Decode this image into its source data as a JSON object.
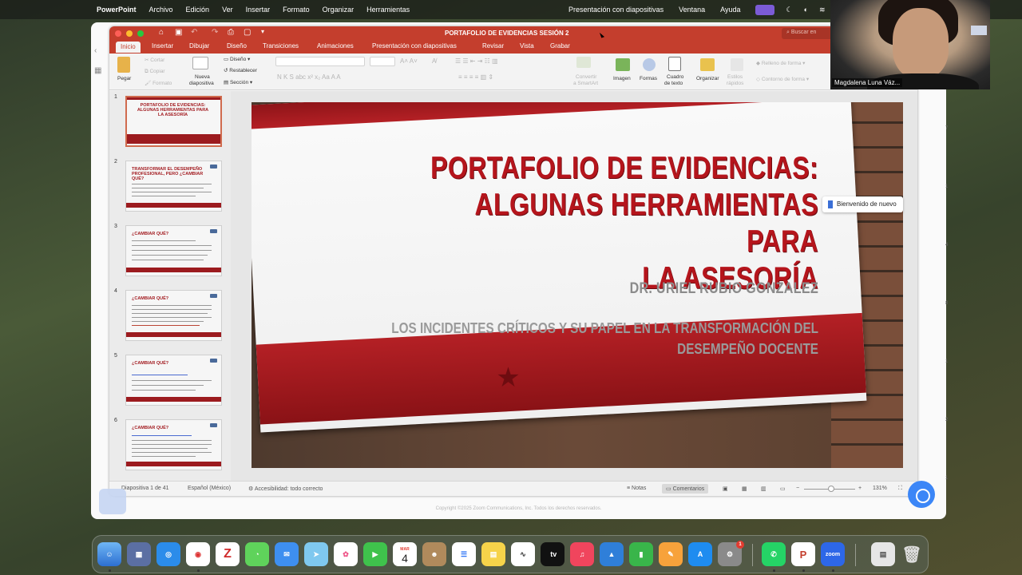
{
  "menubar": {
    "app": "PowerPoint",
    "items": [
      "Archivo",
      "Edición",
      "Ver",
      "Insertar",
      "Formato",
      "Organizar",
      "Herramientas"
    ],
    "right_items": [
      "Presentación con diapositivas",
      "Ventana",
      "Ayuda"
    ]
  },
  "window": {
    "title": "PORTAFOLIO DE EVIDENCIAS SESIÓN 2",
    "search_placeholder": "Buscar en"
  },
  "tabs": [
    "Inicio",
    "Insertar",
    "Dibujar",
    "Diseño",
    "Transiciones",
    "Animaciones",
    "Presentación con diapositivas",
    "Revisar",
    "Vista",
    "Grabar"
  ],
  "ribbon": {
    "pegar": "Pegar",
    "cortar": "Cortar",
    "copiar": "Copiar",
    "formato": "Formato",
    "nueva_diapositiva_1": "Nueva",
    "nueva_diapositiva_2": "diapositiva",
    "diseno": "Diseño",
    "restablecer": "Restablecer",
    "seccion": "Sección",
    "convertir_1": "Convertir",
    "convertir_2": "a SmartArt",
    "imagen": "Imagen",
    "formas": "Formas",
    "cuadro_1": "Cuadro",
    "cuadro_2": "de texto",
    "organizar": "Organizar",
    "estilos_1": "Estilos",
    "estilos_2": "rápidos",
    "relleno": "Relleno de forma",
    "contorno": "Contorno de forma"
  },
  "thumbnails": [
    {
      "num": "1",
      "title": "PORTAFOLIO DE EVIDENCIAS: ALGUNAS HERRAMIENTAS PARA LA ASESORÍA"
    },
    {
      "num": "2",
      "title": "TRANSFORMAR EL DESEMPEÑO PROFESIONAL, PERO ¿CAMBIAR QUÉ?"
    },
    {
      "num": "3",
      "title": "¿CAMBIAR QUÉ?"
    },
    {
      "num": "4",
      "title": "¿CAMBIAR QUÉ?"
    },
    {
      "num": "5",
      "title": "¿CAMBIAR QUÉ?"
    },
    {
      "num": "6",
      "title": "¿CAMBIAR QUÉ?"
    }
  ],
  "slide": {
    "title_line1": "PORTAFOLIO DE EVIDENCIAS:",
    "title_line2": "ALGUNAS HERRAMIENTAS PARA",
    "title_line3": "LA ASESORÍA",
    "author": "DR. URIEL RUBIO GONZALEZ",
    "subtitle_line1": "LOS INCIDENTES CRÍTICOS Y SU PAPEL EN LA TRANSFORMACIÓN DEL",
    "subtitle_line2": "DESEMPEÑO DOCENTE"
  },
  "status": {
    "slide_count": "Diapositiva 1 de 41",
    "language": "Español (México)",
    "accessibility": "Accesibilidad: todo correcto",
    "notes": "Notas",
    "comments": "Comentarios",
    "zoom": "131%"
  },
  "tooltip": "Bienvenido de nuevo",
  "webcam": {
    "name": "Magdalena Luna Váz..."
  },
  "zoom_footer": "Copyright ©2025 Zoom Communications, Inc. Todos los derechos reservados.",
  "dock": {
    "calendar_month": "MAR",
    "calendar_day": "4",
    "settings_badge": "1",
    "tv_label": "tv",
    "zoom_label": "zoom"
  }
}
